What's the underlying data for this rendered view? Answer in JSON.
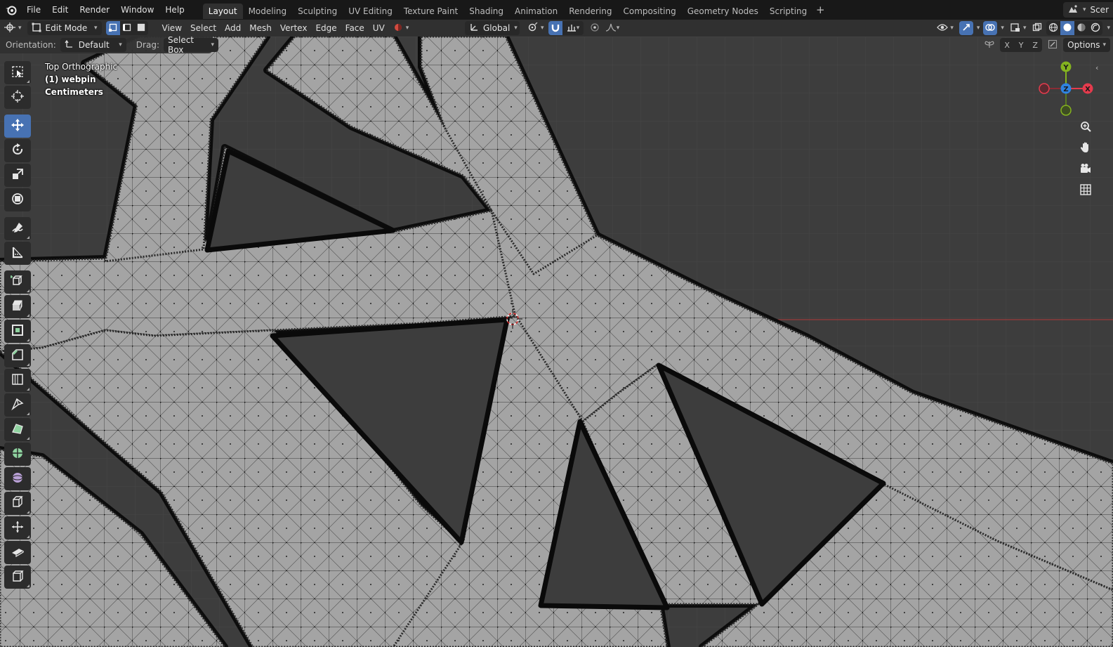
{
  "topbar": {
    "menus": [
      "File",
      "Edit",
      "Render",
      "Window",
      "Help"
    ],
    "workspaces": [
      "Layout",
      "Modeling",
      "Sculpting",
      "UV Editing",
      "Texture Paint",
      "Shading",
      "Animation",
      "Rendering",
      "Compositing",
      "Geometry Nodes",
      "Scripting"
    ],
    "active_workspace": "Layout",
    "add_label": "+",
    "scene_label": "Scer"
  },
  "header": {
    "mode": "Edit Mode",
    "menus": [
      "View",
      "Select",
      "Add",
      "Mesh",
      "Vertex",
      "Edge",
      "Face",
      "UV"
    ],
    "transform_orientation": "Global"
  },
  "toolsettings": {
    "orientation_label": "Orientation:",
    "orientation_value": "Default",
    "drag_label": "Drag:",
    "drag_value": "Select Box",
    "axes": [
      "X",
      "Y",
      "Z"
    ],
    "options_label": "Options"
  },
  "overlay": {
    "view_name": "Top Orthographic",
    "object_name": "(1) webpin",
    "units": "Centimeters"
  },
  "gizmo": {
    "x_label": "X",
    "y_label": "Y",
    "z_label": "Z",
    "x_color": "#e53b4d",
    "y_color": "#84b31f",
    "z_color": "#2f83e1"
  },
  "colors": {
    "accent": "#4772b3",
    "viewport_bg": "#3d3d3d",
    "mesh_fill": "#a3a3a3",
    "edge_dark": "#0a0a0a"
  },
  "icons": {
    "toolbar": [
      "select-box-icon",
      "cursor-icon",
      "move-icon",
      "rotate-icon",
      "scale-icon",
      "transform-icon",
      "annotate-icon",
      "measure-icon",
      "add-cube-icon",
      "extrude-icon",
      "inset-icon",
      "bevel-icon",
      "loop-cut-icon",
      "knife-icon",
      "poly-build-icon",
      "spin-icon",
      "smooth-icon",
      "edge-slide-icon",
      "shrink-fatten-icon",
      "shear-icon",
      "rip-icon"
    ]
  }
}
